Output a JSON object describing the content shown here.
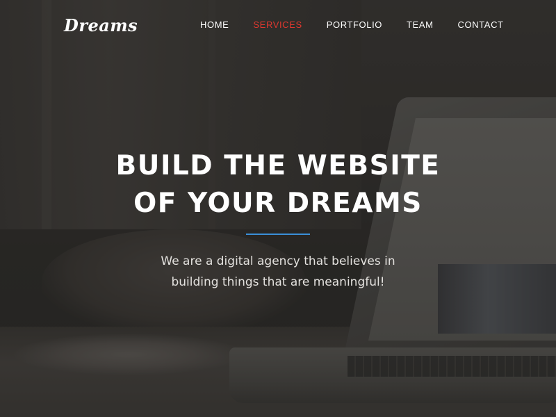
{
  "header": {
    "logo_text": "Dreams"
  },
  "nav": {
    "items": [
      {
        "label": "HOME",
        "active": false
      },
      {
        "label": "SERVICES",
        "active": true
      },
      {
        "label": "PORTFOLIO",
        "active": false
      },
      {
        "label": "TEAM",
        "active": false
      },
      {
        "label": "CONTACT",
        "active": false
      }
    ]
  },
  "hero": {
    "title_line1": "BUILD THE WEBSITE",
    "title_line2": "OF YOUR DREAMS",
    "tagline_line1": "We are a digital agency that believes in",
    "tagline_line2": "building things that are meaningful!"
  },
  "colors": {
    "accent_active_nav": "#e0382f",
    "divider": "#3a8fd8",
    "text": "#ffffff"
  }
}
